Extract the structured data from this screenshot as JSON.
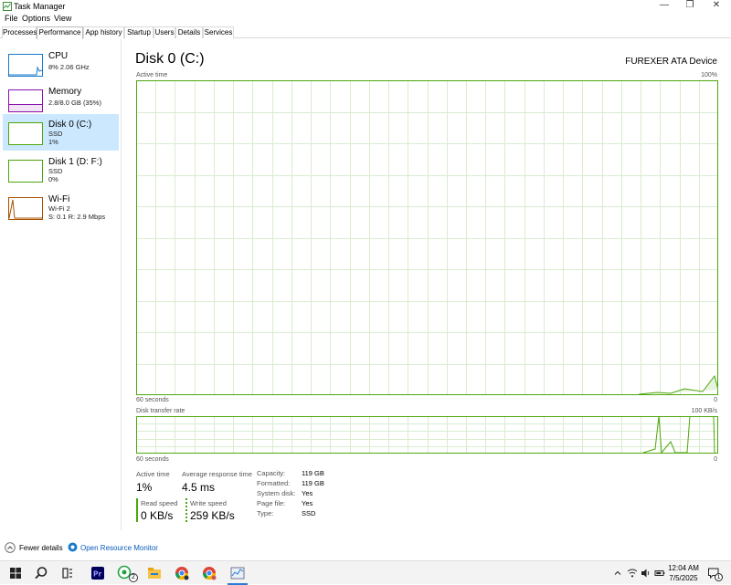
{
  "window": {
    "title": "Task Manager",
    "minimize": "—",
    "maximize": "❐",
    "close": "✕"
  },
  "menu": [
    "File",
    "Options",
    "View"
  ],
  "tabs": [
    "Processes",
    "Performance",
    "App history",
    "Startup",
    "Users",
    "Details",
    "Services"
  ],
  "active_tab": "Performance",
  "sidebar": [
    {
      "title": "CPU",
      "line1": "8% 2.06 GHz",
      "line2": "",
      "color": "#1979ca"
    },
    {
      "title": "Memory",
      "line1": "2.8/8.0 GB (35%)",
      "line2": "",
      "color": "#8b12ae"
    },
    {
      "title": "Disk 0 (C:)",
      "line1": "SSD",
      "line2": "1%",
      "color": "#4da60c"
    },
    {
      "title": "Disk 1 (D: F:)",
      "line1": "SSD",
      "line2": "0%",
      "color": "#4da60c"
    },
    {
      "title": "Wi-Fi",
      "line1": "Wi-Fi 2",
      "line2": "S: 0.1  R: 2.9 Mbps",
      "color": "#a74f01"
    }
  ],
  "main": {
    "title": "Disk 0 (C:)",
    "device": "FUREXER ATA Device",
    "chart1": {
      "label": "Active time",
      "max": "100%",
      "time": "60 seconds",
      "min": "0"
    },
    "chart2": {
      "label": "Disk transfer rate",
      "max": "100 KB/s",
      "time": "60 seconds",
      "min": "0"
    }
  },
  "stats": {
    "active_time_label": "Active time",
    "active_time": "1%",
    "resp_label": "Average response time",
    "resp": "4.5 ms",
    "read_label": "Read speed",
    "read": "0 KB/s",
    "write_label": "Write speed",
    "write": "259 KB/s"
  },
  "props": [
    {
      "k": "Capacity:",
      "v": "119 GB"
    },
    {
      "k": "Formatted:",
      "v": "119 GB"
    },
    {
      "k": "System disk:",
      "v": "Yes"
    },
    {
      "k": "Page file:",
      "v": "Yes"
    },
    {
      "k": "Type:",
      "v": "SSD"
    }
  ],
  "bottom": {
    "fewer": "Fewer details",
    "resmon": "Open Resource Monitor"
  },
  "taskbar": {
    "time": "12:04 AM",
    "date": "7/5/2025",
    "whatsapp_badge": "2",
    "notif_badge": "1"
  }
}
